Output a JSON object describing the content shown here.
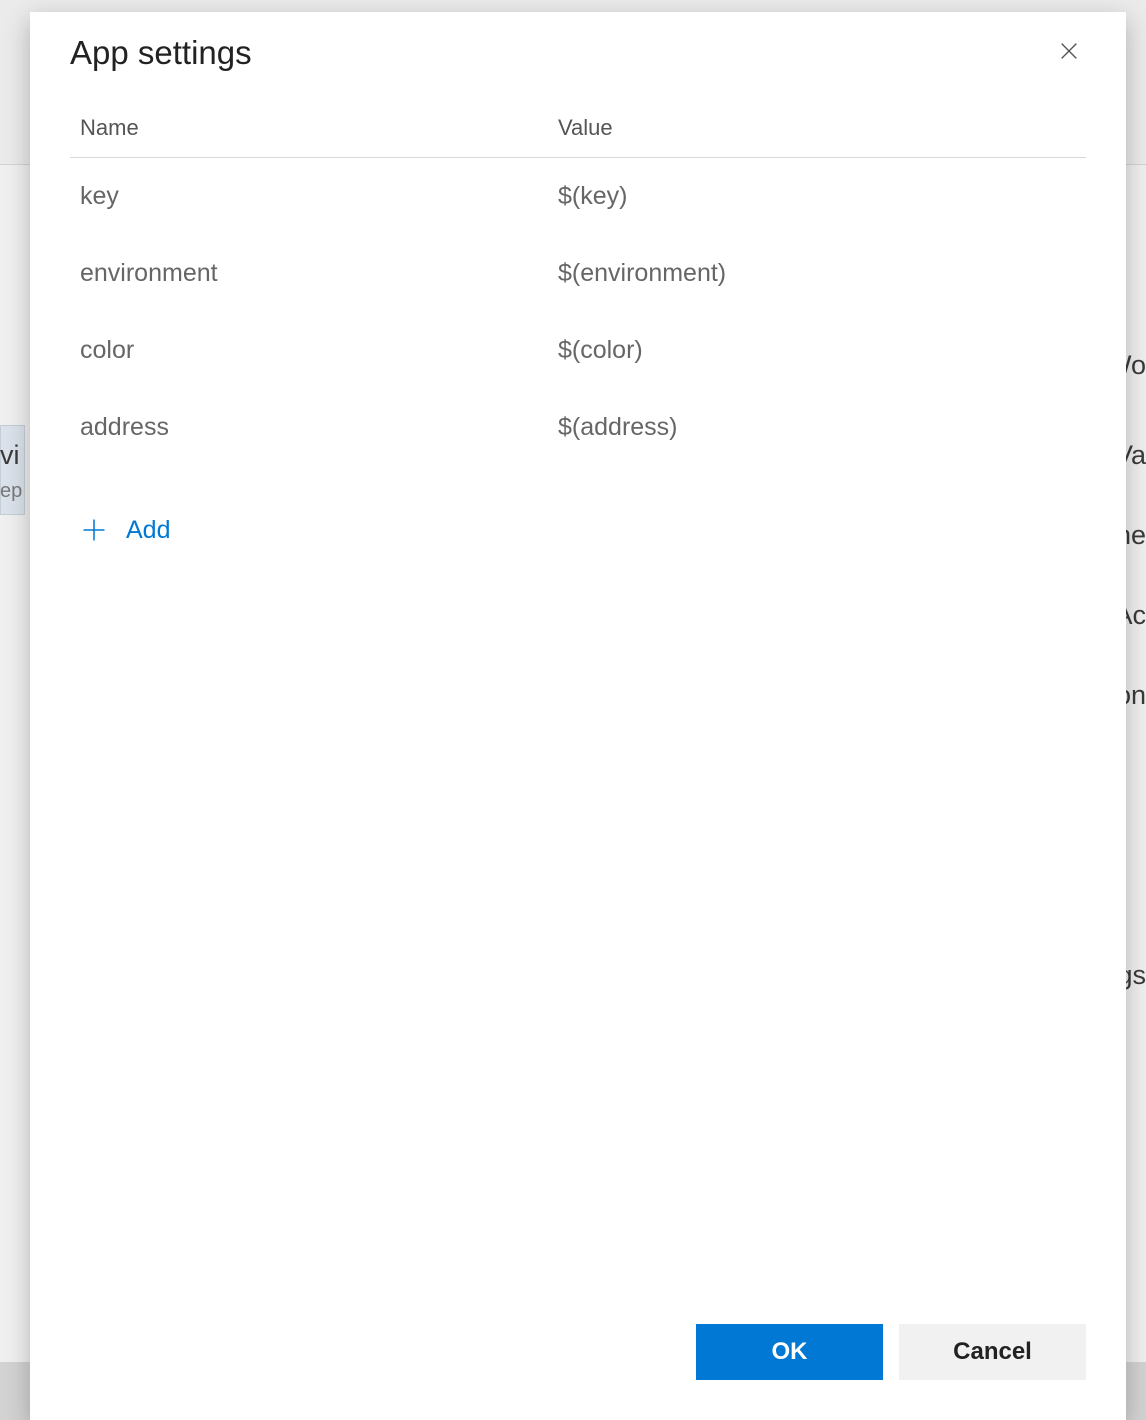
{
  "modal": {
    "title": "App settings",
    "headers": {
      "name": "Name",
      "value": "Value"
    },
    "rows": [
      {
        "name": "key",
        "value": "$(key)"
      },
      {
        "name": "environment",
        "value": "$(environment)"
      },
      {
        "name": "color",
        "value": "$(color)"
      },
      {
        "name": "address",
        "value": "$(address)"
      }
    ],
    "add_label": "Add",
    "buttons": {
      "ok": "OK",
      "cancel": "Cancel"
    }
  },
  "background": {
    "frag1": "vi",
    "frag2": "ep",
    "frag3": "Wo",
    "frag4": "Va",
    "frag5": "ne",
    "frag6": "Ac",
    "frag7": "on",
    "frag8": "gs"
  }
}
